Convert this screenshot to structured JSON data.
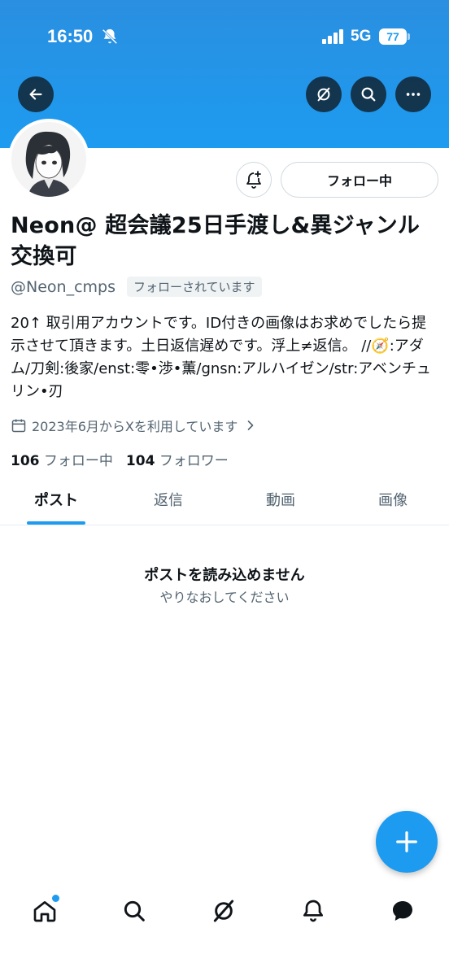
{
  "status_bar": {
    "time": "16:50",
    "network": "5G",
    "battery": "77"
  },
  "profile": {
    "display_name": "Neon@ 超会議25日手渡し&異ジャンル交換可",
    "handle": "@Neon_cmps",
    "follows_you": "フォローされています",
    "follow_button": "フォロー中",
    "bio": "20↑ 取引用アカウントです。ID付きの画像はお求めでしたら提示させて頂きます。土日返信遅めです。浮上≠返信。 //🧭:アダム/刀剣:後家/enst:零•渉•薫/gnsn:アルハイゼン/str:アベンチュリン•刃",
    "joined": "2023年6月からXを利用しています",
    "following_count": "106",
    "following_label": "フォロー中",
    "followers_count": "104",
    "followers_label": "フォロワー"
  },
  "tabs": [
    {
      "label": "ポスト",
      "active": true
    },
    {
      "label": "返信",
      "active": false
    },
    {
      "label": "動画",
      "active": false
    },
    {
      "label": "画像",
      "active": false
    }
  ],
  "empty_state": {
    "title": "ポストを読み込めません",
    "subtitle": "やりなおしてください"
  },
  "colors": {
    "accent": "#1d9bf0",
    "text": "#0f1419",
    "muted": "#536471"
  }
}
